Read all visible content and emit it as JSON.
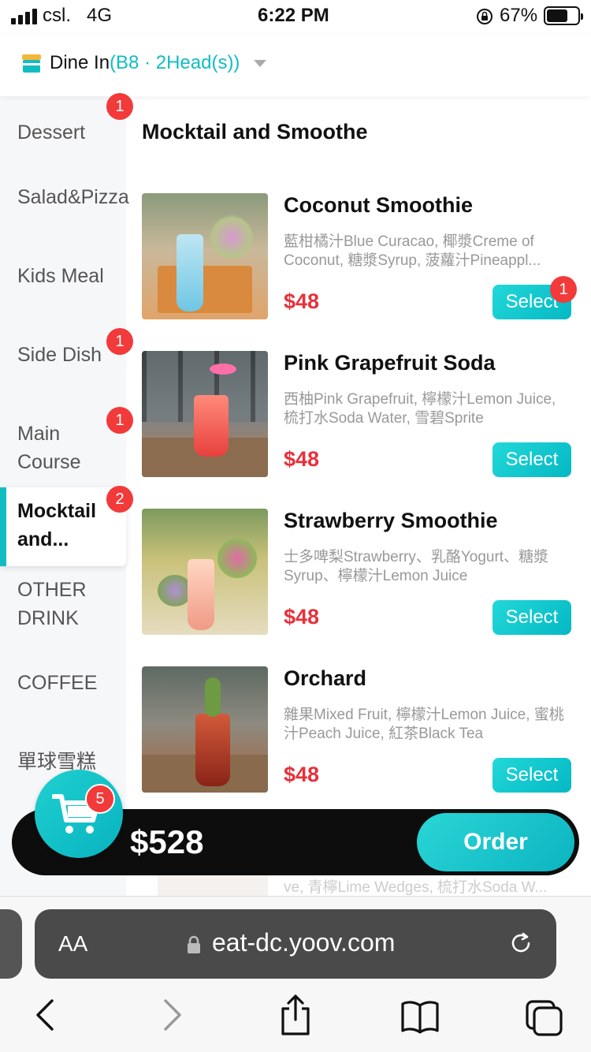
{
  "status_bar": {
    "carrier": "csl.",
    "network": "4G",
    "time": "6:22 PM",
    "battery": "67%"
  },
  "header": {
    "mode": "Dine In",
    "table_info": "(B8 · 2Head(s))",
    "icon": "store-icon"
  },
  "sidebar": {
    "categories": [
      {
        "label": "Dessert",
        "badge": "1"
      },
      {
        "label": "Salad&Pizza",
        "badge": ""
      },
      {
        "label": "Kids Meal",
        "badge": ""
      },
      {
        "label": "Side Dish",
        "badge": "1"
      },
      {
        "label": "Main Course",
        "badge": "1"
      },
      {
        "label": "Mocktail and...",
        "badge": "2",
        "active": true
      },
      {
        "label": "OTHER DRINK",
        "badge": ""
      },
      {
        "label": "COFFEE",
        "badge": ""
      },
      {
        "label": "單球雪糕",
        "badge": ""
      }
    ]
  },
  "section": {
    "title": "Mocktail and Smoothe"
  },
  "items": [
    {
      "name": "Coconut Smoothie",
      "desc": "藍柑橘汁Blue Curacao, 椰漿Creme of Coconut, 糖漿Syrup, 菠蘿汁Pineappl...",
      "price": "$48",
      "button": "Select",
      "badge": "1"
    },
    {
      "name": "Pink Grapefruit Soda",
      "desc": "西柚Pink Grapefruit, 檸檬汁Lemon Juice, 梳打水Soda Water, 雪碧Sprite",
      "price": "$48",
      "button": "Select",
      "badge": ""
    },
    {
      "name": "Strawberry Smoothie",
      "desc": "士多啤梨Strawberry、乳酪Yogurt、糖漿Syrup、檸檬汁Lemon Juice",
      "price": "$48",
      "button": "Select",
      "badge": ""
    },
    {
      "name": "Orchard",
      "desc": "雜果Mixed Fruit, 檸檬汁Lemon Juice, 蜜桃汁Peach Juice, 紅茶Black Tea",
      "price": "$48",
      "button": "Select",
      "badge": ""
    }
  ],
  "next_item_partial": "ve, 青檸Lime Wedges, 梳打水Soda W...",
  "cart": {
    "count": "5",
    "total": "$528",
    "order_label": "Order"
  },
  "browser": {
    "text_size": "AA",
    "url": "eat-dc.yoov.com"
  },
  "colors": {
    "accent": "#12bdc2",
    "price": "#e8303a",
    "badge": "#f23a3a"
  }
}
